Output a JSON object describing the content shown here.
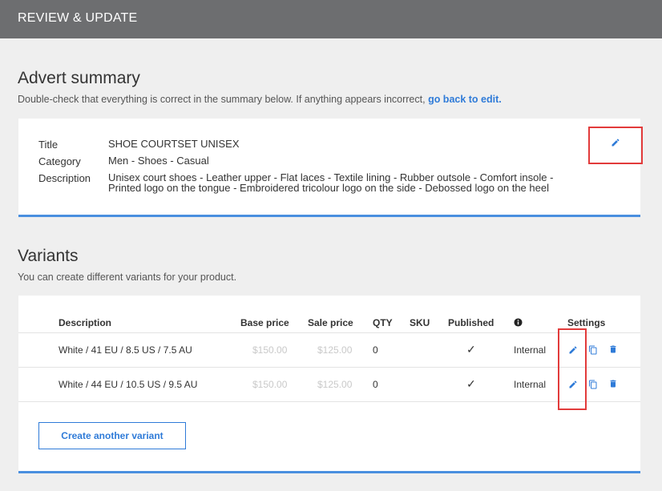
{
  "header": {
    "title": "REVIEW & UPDATE"
  },
  "summary": {
    "heading": "Advert summary",
    "subtitle_prefix": "Double-check that everything is correct in the summary below. If anything appears incorrect,",
    "subtitle_link": "go back to edit.",
    "fields": {
      "title_label": "Title",
      "title_value": "SHOE COURTSET UNISEX",
      "category_label": "Category",
      "category_value": "Men - Shoes - Casual",
      "description_label": "Description",
      "description_line1": "Unisex court shoes - Leather upper - Flat laces - Textile lining - Rubber outsole - Comfort insole -",
      "description_line2": "Printed logo on the tongue - Embroidered tricolour logo on the side - Debossed logo on the heel"
    },
    "edit_icon": "pencil-icon"
  },
  "variants": {
    "heading": "Variants",
    "subtitle": "You can create different variants for your product.",
    "columns": {
      "description": "Description",
      "base_price": "Base price",
      "sale_price": "Sale price",
      "qty": "QTY",
      "sku": "SKU",
      "published": "Published",
      "info_icon": "info-icon",
      "settings": "Settings"
    },
    "rows": [
      {
        "description": "White / 41 EU / 8.5 US / 7.5 AU",
        "base_price": "$150.00",
        "sale_price": "$125.00",
        "qty": "0",
        "sku": "",
        "published": "✓",
        "visibility": "Internal"
      },
      {
        "description": "White / 44 EU / 10.5 US / 9.5 AU",
        "base_price": "$150.00",
        "sale_price": "$125.00",
        "qty": "0",
        "sku": "",
        "published": "✓",
        "visibility": "Internal"
      }
    ],
    "create_button": "Create another variant"
  },
  "colors": {
    "accent": "#2f7bd8",
    "highlight": "#e23b3b",
    "topbar": "#6d6e70"
  }
}
